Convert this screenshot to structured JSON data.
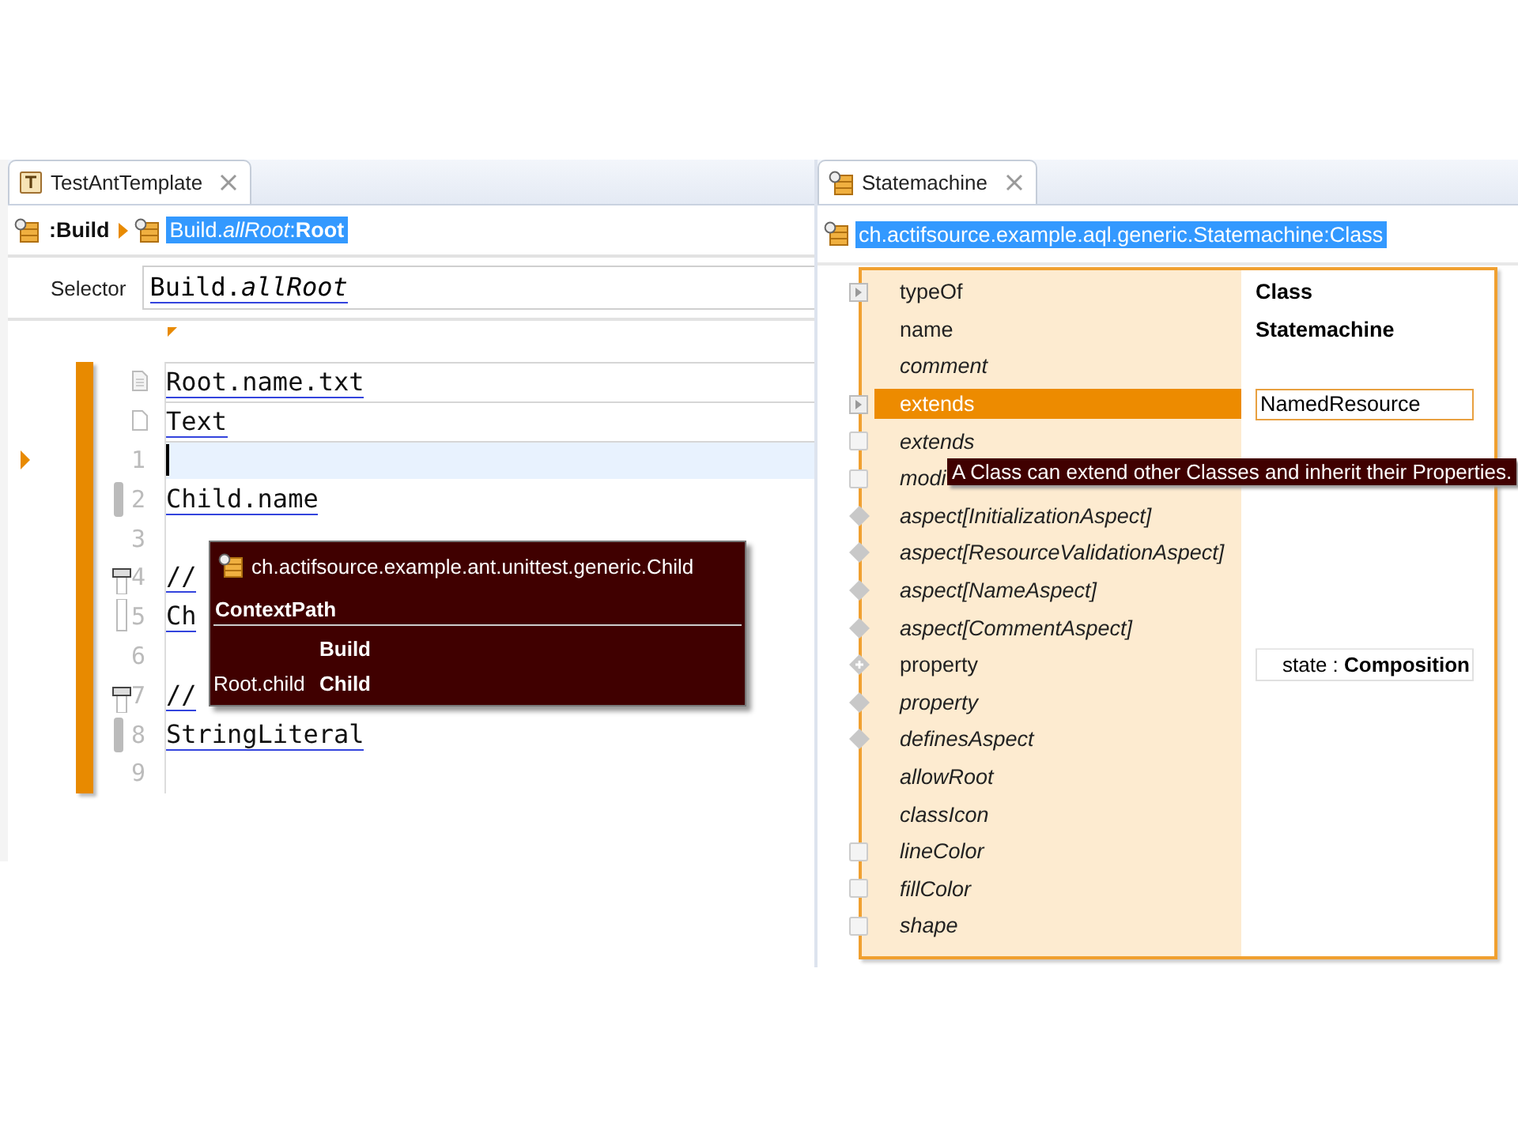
{
  "left_editor": {
    "tab": {
      "title": "TestAntTemplate",
      "selected": true
    },
    "breadcrumb": [
      {
        "text": "**:Build**",
        "selected": false
      },
      {
        "text": "Build.*allRoot*:**Root**",
        "selected": true
      }
    ],
    "selector": {
      "label": "Selector",
      "value": "Build.*allRoot*"
    },
    "header_lines": [
      {
        "kind": "file",
        "text": "Root.name.txt"
      },
      {
        "kind": "doc",
        "text": "Text"
      }
    ],
    "lines": [
      {
        "number": "1",
        "current": true,
        "kind": "plain"
      },
      {
        "number": "2",
        "text": "Child.name",
        "current": false,
        "kind": "bar"
      },
      {
        "number": "3",
        "current": false,
        "kind": "plain"
      },
      {
        "number": "4",
        "text": "//",
        "current": false,
        "kind": "handle"
      },
      {
        "number": "5",
        "text": "Ch",
        "current": false,
        "kind": "track"
      },
      {
        "number": "6",
        "current": false,
        "kind": "plain"
      },
      {
        "number": "7",
        "text": "//",
        "current": false,
        "kind": "handle"
      },
      {
        "number": "8",
        "text": "StringLiteral",
        "current": false,
        "kind": "bar"
      },
      {
        "number": "9",
        "current": false,
        "kind": "plain"
      }
    ],
    "popup": {
      "title": "ch.actifsource.example.ant.unittest.generic.Child",
      "section": "ContextPath",
      "rows": [
        [
          "",
          "Build"
        ],
        [
          "Root.child",
          "Child"
        ]
      ]
    }
  },
  "right_editor": {
    "tab": {
      "title": "Statemachine",
      "selected": true
    },
    "breadcrumb": {
      "text": "ch.actifsource.example.aql.generic.Statemachine:Class",
      "selected": true
    },
    "properties": [
      {
        "name": "typeOf",
        "kind": "expand",
        "italic": false,
        "selected": false,
        "value": {
          "kind": "bold",
          "text": "Class"
        }
      },
      {
        "name": "name",
        "kind": "none",
        "italic": false,
        "selected": false,
        "value": {
          "kind": "bold",
          "text": "Statemachine"
        }
      },
      {
        "name": "comment",
        "kind": "none",
        "italic": true,
        "selected": false
      },
      {
        "name": "extends",
        "kind": "expand",
        "italic": false,
        "selected": true,
        "value": {
          "kind": "field",
          "text": "NamedResource"
        }
      },
      {
        "name": "extends",
        "kind": "square",
        "italic": true,
        "selected": false
      },
      {
        "name": "modi",
        "kind": "square",
        "italic": true,
        "selected": false
      },
      {
        "name": "aspect[InitializationAspect]",
        "kind": "diamond",
        "italic": true,
        "selected": false
      },
      {
        "name": "aspect[ResourceValidationAspect]",
        "kind": "diamond",
        "italic": true,
        "selected": false
      },
      {
        "name": "aspect[NameAspect]",
        "kind": "diamond",
        "italic": true,
        "selected": false
      },
      {
        "name": "aspect[CommentAspect]",
        "kind": "diamond",
        "italic": true,
        "selected": false
      },
      {
        "name": "property",
        "kind": "plus",
        "italic": false,
        "selected": false,
        "value": {
          "kind": "tag",
          "text": "state : **Composition**"
        }
      },
      {
        "name": "property",
        "kind": "diamond",
        "italic": true,
        "selected": false
      },
      {
        "name": "definesAspect",
        "kind": "diamond",
        "italic": true,
        "selected": false
      },
      {
        "name": "allowRoot",
        "kind": "none",
        "italic": true,
        "selected": false
      },
      {
        "name": "classIcon",
        "kind": "none",
        "italic": true,
        "selected": false
      },
      {
        "name": "lineColor",
        "kind": "square",
        "italic": true,
        "selected": false
      },
      {
        "name": "fillColor",
        "kind": "square",
        "italic": true,
        "selected": false
      },
      {
        "name": "shape",
        "kind": "square",
        "italic": true,
        "selected": false
      }
    ],
    "tooltip": "A Class can extend other Classes and inherit their Properties."
  }
}
